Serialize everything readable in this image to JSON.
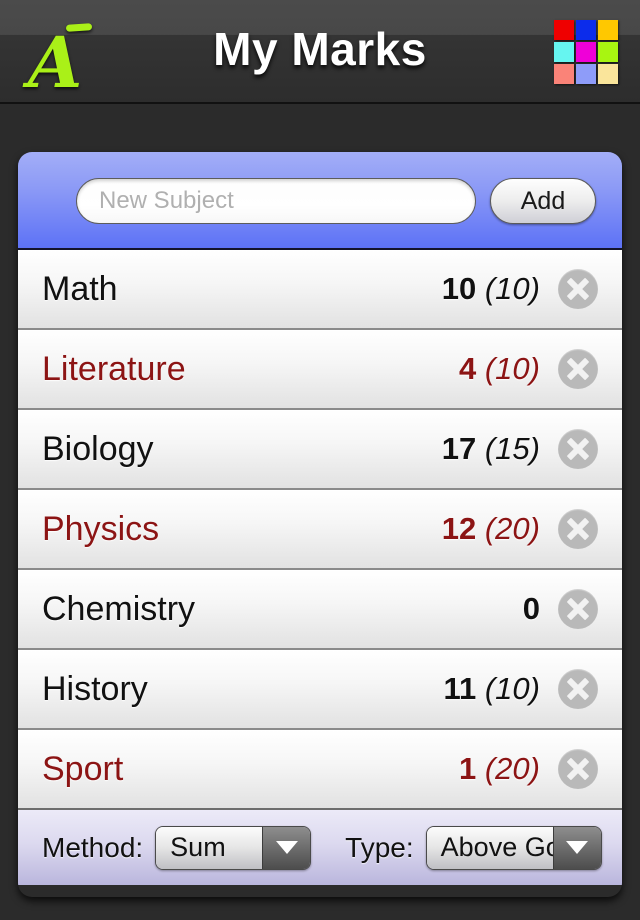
{
  "navbar": {
    "title": "My Marks",
    "logo_letter": "A",
    "logo_icon": "a-macron-logo",
    "color_grid": {
      "icon": "color-palette-grid-icon",
      "swatches": [
        "#ef0000",
        "#0c2ceb",
        "#ffc800",
        "#66f5f0",
        "#ef00d8",
        "#a8f511",
        "#fa8378",
        "#8e9cf9",
        "#fae59b"
      ]
    }
  },
  "add_bar": {
    "input_placeholder": "New Subject",
    "input_value": "",
    "add_label": "Add"
  },
  "list": {
    "rows": [
      {
        "name": "Math",
        "score": "10",
        "goal": "(10)",
        "below_goal": false
      },
      {
        "name": "Literature",
        "score": "4",
        "goal": "(10)",
        "below_goal": true
      },
      {
        "name": "Biology",
        "score": "17",
        "goal": "(15)",
        "below_goal": false
      },
      {
        "name": "Physics",
        "score": "12",
        "goal": "(20)",
        "below_goal": true
      },
      {
        "name": "Chemistry",
        "score": "0",
        "goal": "",
        "below_goal": false
      },
      {
        "name": "History",
        "score": "11",
        "goal": "(10)",
        "below_goal": false
      },
      {
        "name": "Sport",
        "score": "1",
        "goal": "(20)",
        "below_goal": true
      }
    ],
    "delete_icon": "delete-circle-x-icon"
  },
  "bottom_bar": {
    "method_label": "Method:",
    "method_value": "Sum",
    "type_label": "Type:",
    "type_value": "Above Goal",
    "arrow_icon": "chevron-down-icon"
  },
  "colors": {
    "below_goal_text": "#8c1414",
    "normal_text": "#111111",
    "accent_blue": "#5d72f6",
    "logo_green": "#aaf018"
  }
}
